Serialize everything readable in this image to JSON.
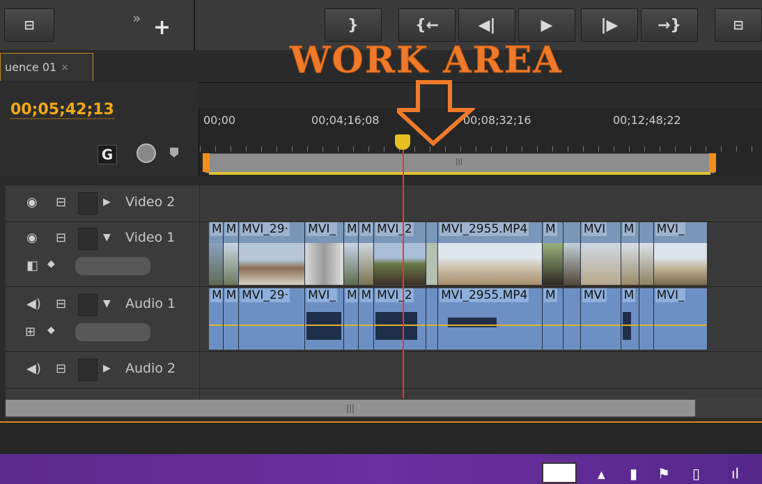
{
  "sequence_tab": {
    "label": "uence 01",
    "close": "×"
  },
  "annotation": {
    "work_area": "WORK AREA"
  },
  "timecode": "00;05;42;13",
  "toolbar": {
    "expand": "»",
    "add": "+",
    "buttons": [
      "}",
      "{←",
      "◀|",
      "▶",
      "|▶",
      "→}"
    ]
  },
  "ruler": {
    "labels": [
      "00;00",
      "00;04;16;08",
      "00;08;32;16",
      "00;12;48;22"
    ]
  },
  "work_area_bar": {
    "grip": "|||"
  },
  "tracks": {
    "video2": "Video 2",
    "video1": "Video 1",
    "audio1": "Audio 1",
    "audio2": "Audio 2"
  },
  "clips": {
    "video": [
      "M",
      "M",
      "MVI_29·",
      "MVI_",
      "M",
      "M",
      "MVI_2",
      "",
      "MVI_2955.MP4",
      "M",
      "",
      "MVI",
      "M",
      "",
      "MVI_"
    ],
    "audio": [
      "M",
      "M",
      "MVI_29·",
      "MVI_",
      "M",
      "M",
      "MVI_2",
      "",
      "MVI_2955.MP4",
      "M",
      "",
      "MVI",
      "M",
      "",
      "MVI_"
    ]
  },
  "scrollbar": {
    "grip": "|||"
  },
  "colors": {
    "accent": "#f2a817",
    "annotation": "#f07a2a",
    "playhead": "#e53a2a",
    "video_clip": "#7a96b8",
    "audio_clip": "#6d90c4",
    "taskbar": "#6b2fa0"
  }
}
